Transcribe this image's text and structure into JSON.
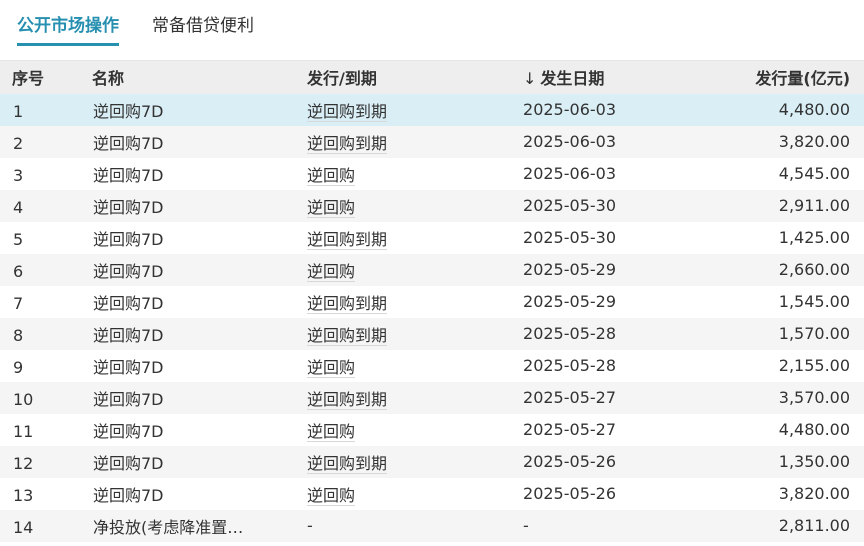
{
  "tabs": [
    {
      "label": "公开市场操作",
      "active": true
    },
    {
      "label": "常备借贷便利",
      "active": false
    }
  ],
  "table": {
    "headers": {
      "index": "序号",
      "name": "名称",
      "action": "发行/到期",
      "sort_arrow": "↓",
      "date": "发生日期",
      "amount": "发行量(亿元)"
    },
    "rows": [
      {
        "index": "1",
        "name": "逆回购7D",
        "action": "逆回购到期",
        "date": "2025-06-03",
        "amount": "4,480.00"
      },
      {
        "index": "2",
        "name": "逆回购7D",
        "action": "逆回购到期",
        "date": "2025-06-03",
        "amount": "3,820.00"
      },
      {
        "index": "3",
        "name": "逆回购7D",
        "action": "逆回购",
        "date": "2025-06-03",
        "amount": "4,545.00"
      },
      {
        "index": "4",
        "name": "逆回购7D",
        "action": "逆回购",
        "date": "2025-05-30",
        "amount": "2,911.00"
      },
      {
        "index": "5",
        "name": "逆回购7D",
        "action": "逆回购到期",
        "date": "2025-05-30",
        "amount": "1,425.00"
      },
      {
        "index": "6",
        "name": "逆回购7D",
        "action": "逆回购",
        "date": "2025-05-29",
        "amount": "2,660.00"
      },
      {
        "index": "7",
        "name": "逆回购7D",
        "action": "逆回购到期",
        "date": "2025-05-29",
        "amount": "1,545.00"
      },
      {
        "index": "8",
        "name": "逆回购7D",
        "action": "逆回购到期",
        "date": "2025-05-28",
        "amount": "1,570.00"
      },
      {
        "index": "9",
        "name": "逆回购7D",
        "action": "逆回购",
        "date": "2025-05-28",
        "amount": "2,155.00"
      },
      {
        "index": "10",
        "name": "逆回购7D",
        "action": "逆回购到期",
        "date": "2025-05-27",
        "amount": "3,570.00"
      },
      {
        "index": "11",
        "name": "逆回购7D",
        "action": "逆回购",
        "date": "2025-05-27",
        "amount": "4,480.00"
      },
      {
        "index": "12",
        "name": "逆回购7D",
        "action": "逆回购到期",
        "date": "2025-05-26",
        "amount": "1,350.00"
      },
      {
        "index": "13",
        "name": "逆回购7D",
        "action": "逆回购",
        "date": "2025-05-26",
        "amount": "3,820.00"
      },
      {
        "index": "14",
        "name": "净投放(考虑降准置…",
        "action": "-",
        "date": "-",
        "amount": "2,811.00"
      }
    ]
  }
}
